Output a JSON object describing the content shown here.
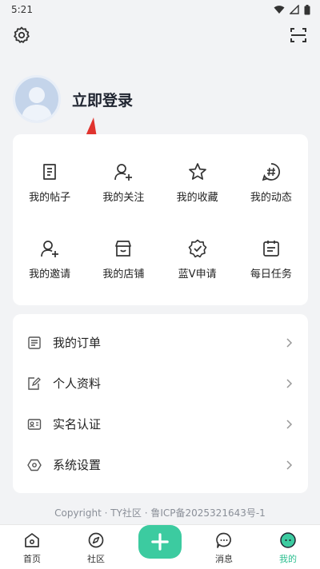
{
  "status_bar": {
    "time": "5:21"
  },
  "profile": {
    "login_label": "立即登录"
  },
  "grid": [
    {
      "label": "我的帖子"
    },
    {
      "label": "我的关注"
    },
    {
      "label": "我的收藏"
    },
    {
      "label": "我的动态"
    },
    {
      "label": "我的邀请"
    },
    {
      "label": "我的店铺"
    },
    {
      "label": "蓝V申请"
    },
    {
      "label": "每日任务"
    }
  ],
  "menu": [
    {
      "label": "我的订单"
    },
    {
      "label": "个人资料"
    },
    {
      "label": "实名认证"
    },
    {
      "label": "系统设置"
    }
  ],
  "copyright": "Copyright · TY社区 · 鲁ICP备2025321643号-1",
  "tabs": [
    {
      "label": "首页"
    },
    {
      "label": "社区"
    },
    {
      "label": ""
    },
    {
      "label": "消息"
    },
    {
      "label": "我的"
    }
  ],
  "colors": {
    "accent": "#2bbf8f",
    "arrow": "#e0332e"
  }
}
